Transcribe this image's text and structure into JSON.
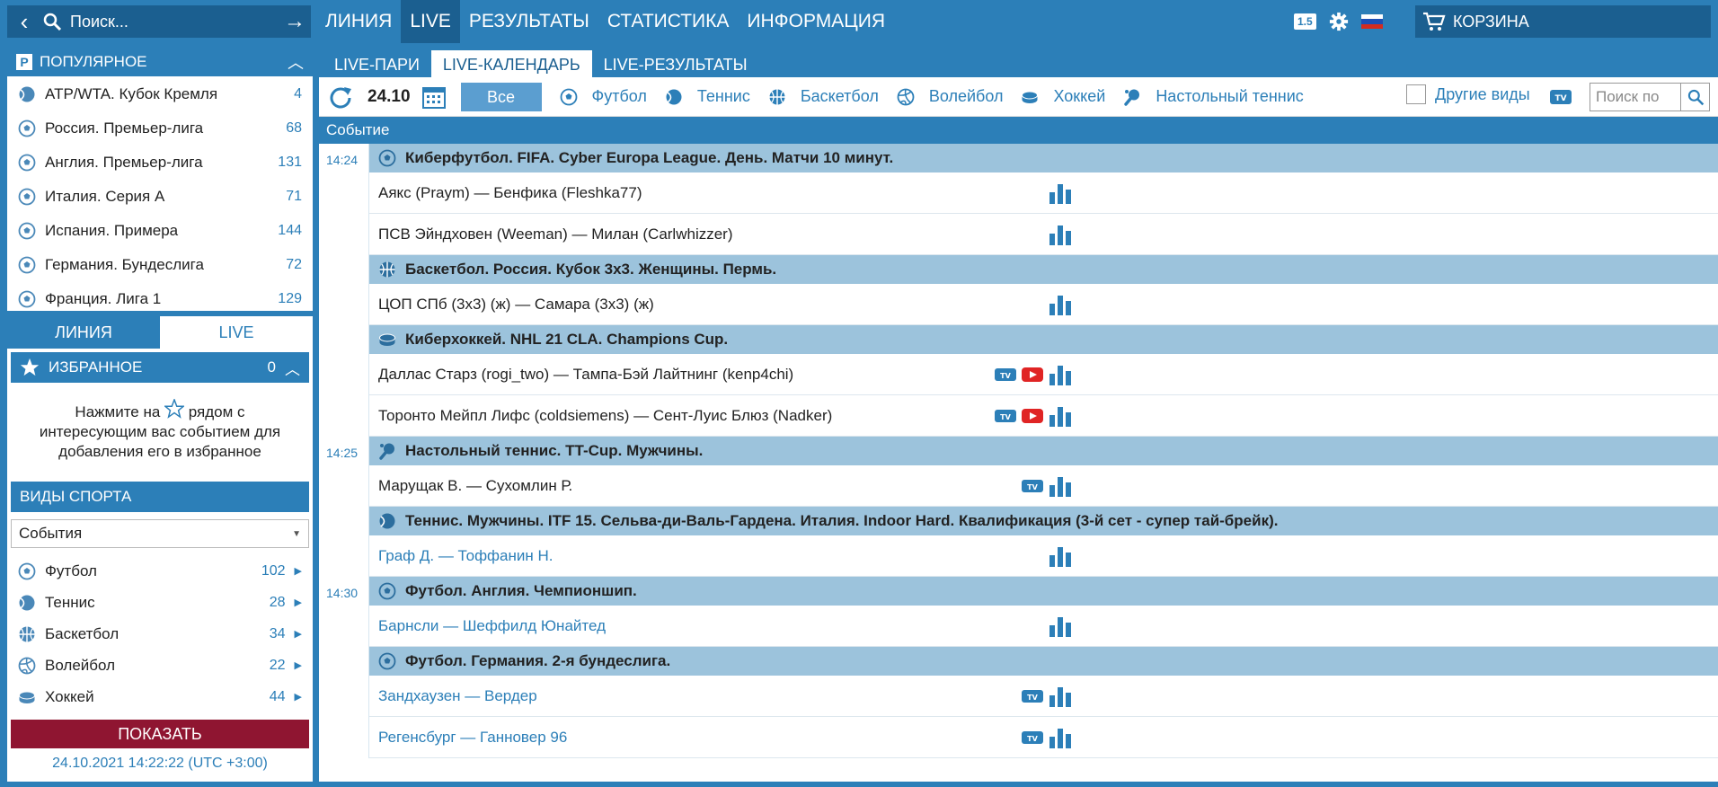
{
  "top": {
    "search_placeholder": "Поиск...",
    "nav": [
      "ЛИНИЯ",
      "LIVE",
      "РЕЗУЛЬТАТЫ",
      "СТАТИСТИКА",
      "ИНФОРМАЦИЯ"
    ],
    "active_nav": "LIVE",
    "odds_format": "1.5",
    "cart": "КОРЗИНА"
  },
  "sidebar": {
    "popular_title": "ПОПУЛЯРНОЕ",
    "popular": [
      {
        "name": "ATP/WTA. Кубок Кремля",
        "count": "4",
        "icon": "tennis"
      },
      {
        "name": "Россия. Премьер-лига",
        "count": "68",
        "icon": "football"
      },
      {
        "name": "Англия. Премьер-лига",
        "count": "131",
        "icon": "football"
      },
      {
        "name": "Италия. Серия А",
        "count": "71",
        "icon": "football"
      },
      {
        "name": "Испания. Примера",
        "count": "144",
        "icon": "football"
      },
      {
        "name": "Германия. Бундеслига",
        "count": "72",
        "icon": "football"
      },
      {
        "name": "Франция. Лига 1",
        "count": "129",
        "icon": "football"
      }
    ],
    "tab_line": "ЛИНИЯ",
    "tab_live": "LIVE",
    "favorites_title": "ИЗБРАННОЕ",
    "favorites_count": "0",
    "favorites_hint_1": "Нажмите на",
    "favorites_hint_2": "рядом с интересующим вас событием для добавления его в избранное",
    "sports_title": "ВИДЫ СПОРТА",
    "select_value": "События",
    "sports": [
      {
        "name": "Футбол",
        "count": "102",
        "icon": "football"
      },
      {
        "name": "Теннис",
        "count": "28",
        "icon": "tennis"
      },
      {
        "name": "Баскетбол",
        "count": "34",
        "icon": "basketball"
      },
      {
        "name": "Волейбол",
        "count": "22",
        "icon": "volleyball"
      },
      {
        "name": "Хоккей",
        "count": "44",
        "icon": "hockey"
      }
    ],
    "show_button": "ПОКАЗАТЬ",
    "datetime": "24.10.2021 14:22:22 (UTC +3:00)"
  },
  "main": {
    "tabs": [
      "LIVE-ПАРИ",
      "LIVE-КАЛЕНДАРЬ",
      "LIVE-РЕЗУЛЬТАТЫ"
    ],
    "active_tab": "LIVE-КАЛЕНДАРЬ",
    "date": "24.10",
    "all_label": "Все",
    "sport_filters": [
      {
        "name": "Футбол",
        "icon": "football"
      },
      {
        "name": "Теннис",
        "icon": "tennis"
      },
      {
        "name": "Баскетбол",
        "icon": "basketball"
      },
      {
        "name": "Волейбол",
        "icon": "volleyball"
      },
      {
        "name": "Хоккей",
        "icon": "hockey"
      },
      {
        "name": "Настольный теннис",
        "icon": "tabletennis"
      }
    ],
    "other_sports": "Другие виды",
    "search_placeholder": "Поиск по",
    "column_event": "Событие",
    "blocks": [
      {
        "time": "14:24",
        "leagues": [
          {
            "title": "Киберфутбол. FIFA. Cyber Europa League. День. Матчи 10 минут.",
            "icon": "football",
            "matches": [
              {
                "name": "Аякс (Praym) — Бенфика (Fleshka77)",
                "tv": false,
                "yt": false,
                "link": false
              },
              {
                "name": "ПСВ Эйндховен (Weeman) — Милан (Carlwhizzer)",
                "tv": false,
                "yt": false,
                "link": false
              }
            ]
          },
          {
            "title": "Баскетбол. Россия. Кубок 3х3. Женщины. Пермь.",
            "icon": "basketball",
            "matches": [
              {
                "name": "ЦОП СПб (3х3) (ж) — Самара (3х3) (ж)",
                "tv": false,
                "yt": false,
                "link": false
              }
            ]
          },
          {
            "title": "Киберхоккей. NHL 21 CLA. Champions Cup.",
            "icon": "hockey",
            "matches": [
              {
                "name": "Даллас Старз (rogi_two) — Тампа-Бэй Лайтнинг (kenp4chi)",
                "tv": true,
                "yt": true,
                "link": false
              },
              {
                "name": "Торонто Мейпл Лифс (coldsiemens) — Сент-Луис Блюз (Nadker)",
                "tv": true,
                "yt": true,
                "link": false
              }
            ]
          }
        ]
      },
      {
        "time": "14:25",
        "leagues": [
          {
            "title": "Настольный теннис. TT-Cup. Мужчины.",
            "icon": "tabletennis",
            "matches": [
              {
                "name": "Марущак В. — Сухомлин Р.",
                "tv": true,
                "yt": false,
                "link": false
              }
            ]
          },
          {
            "title": "Теннис. Мужчины. ITF 15. Сельва-ди-Валь-Гардена. Италия. Indoor Hard. Квалификация (3-й сет - супер тай-брейк).",
            "icon": "tennis",
            "matches": [
              {
                "name": "Граф Д. — Тоффанин Н.",
                "tv": false,
                "yt": false,
                "link": true
              }
            ]
          }
        ]
      },
      {
        "time": "14:30",
        "leagues": [
          {
            "title": "Футбол. Англия. Чемпионшип.",
            "icon": "football",
            "matches": [
              {
                "name": "Барнсли — Шеффилд Юнайтед",
                "tv": false,
                "yt": false,
                "link": true
              }
            ]
          },
          {
            "title": "Футбол. Германия. 2-я бундеслига.",
            "icon": "football",
            "matches": [
              {
                "name": "Зандхаузен — Вердер",
                "tv": true,
                "yt": false,
                "link": true
              },
              {
                "name": "Регенсбург — Ганновер 96",
                "tv": true,
                "yt": false,
                "link": true
              }
            ]
          }
        ]
      }
    ]
  },
  "colors": {
    "primary": "#2c7fb8",
    "dark": "#1b5f90",
    "league_row": "#9cc3dc",
    "show_button": "#8f1531"
  }
}
